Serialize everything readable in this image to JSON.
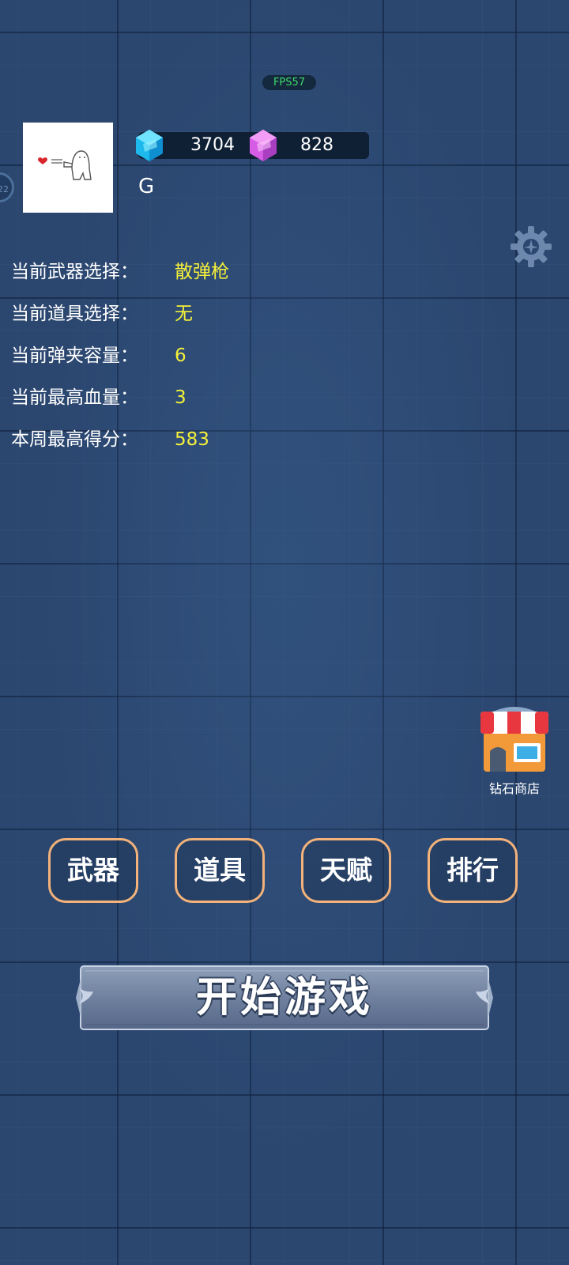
{
  "fps": "FPS57",
  "side_bubble": "22",
  "currency": {
    "blue_gem": "3704",
    "purple_gem": "828"
  },
  "username": "G",
  "stats": [
    {
      "label": "当前武器选择：",
      "value": "散弹枪"
    },
    {
      "label": "当前道具选择：",
      "value": "无"
    },
    {
      "label": "当前弹夹容量：",
      "value": "6"
    },
    {
      "label": "当前最高血量：",
      "value": "3"
    },
    {
      "label": "本周最高得分：",
      "value": "583"
    }
  ],
  "shop": {
    "label": "钻石商店"
  },
  "menu": {
    "weapons": "武器",
    "items": "道具",
    "talent": "天赋",
    "ranking": "排行"
  },
  "start": {
    "label": "开始游戏"
  },
  "colors": {
    "background": "#2b4770",
    "stat_value": "#f5f03a",
    "button_border": "#f2b27a",
    "fps_text": "#3fdc6a"
  },
  "icons": {
    "blue_gem": "blue-gem-icon",
    "purple_gem": "purple-gem-icon",
    "settings": "gear-icon",
    "shop": "shop-icon"
  }
}
